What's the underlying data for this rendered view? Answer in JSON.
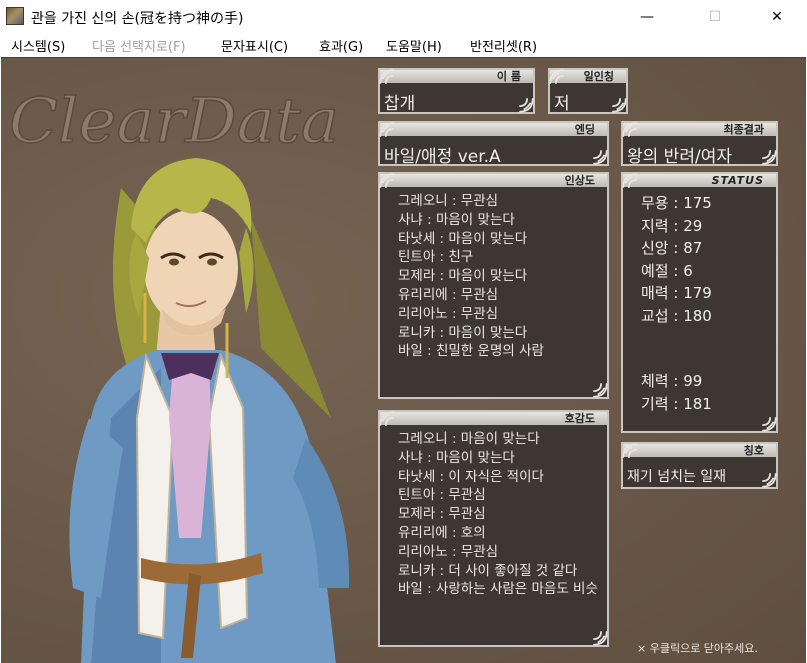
{
  "window": {
    "title": "관을 가진 신의 손(冠を持つ神の手)",
    "minimize": "—",
    "maximize": "☐",
    "close": "✕"
  },
  "menu": [
    {
      "label": "시스템(S)",
      "enabled": true
    },
    {
      "label": "다음 선택지로(F)",
      "enabled": false
    },
    {
      "label": "문자표시(C)",
      "enabled": true
    },
    {
      "label": "효과(G)",
      "enabled": true
    },
    {
      "label": "도움말(H)",
      "enabled": true
    },
    {
      "label": "반전리셋(R)",
      "enabled": true
    }
  ],
  "logo_text": "ClearData",
  "name_panel": {
    "label": "이 름",
    "value": "찹개"
  },
  "pronoun_panel": {
    "label": "일인칭",
    "value": "저"
  },
  "ending_panel": {
    "label": "엔딩",
    "value": "바일/애정   ver.A"
  },
  "result_panel": {
    "label": "최종결과",
    "value": "왕의 반려/여자"
  },
  "impression_panel": {
    "label": "인상도",
    "rows": [
      "그레오니 : 무관심",
      "사냐 : 마음이 맞는다",
      "타낫세 : 마음이 맞는다",
      "틴트아 : 친구",
      "모제라 : 마음이 맞는다",
      "유리리에 : 무관심",
      "리리아노 : 무관심",
      "로니카 : 마음이 맞는다",
      "바일 : 친밀한 운명의 사람"
    ]
  },
  "affection_panel": {
    "label": "호감도",
    "rows": [
      "그레오니 : 마음이 맞는다",
      "사냐 : 마음이 맞는다",
      "타낫세 : 이 자식은 적이다",
      "틴트아 : 무관심",
      "모제라 : 무관심",
      "유리리에 : 호의",
      "리리아노 : 무관심",
      "로니카 : 더 사이 좋아질 것 같다",
      "바일 : 사랑하는 사람은 마음도 비슷"
    ]
  },
  "status_panel": {
    "label": "STATUS",
    "stats": [
      "무용 : 175",
      "지력 : 29",
      "신앙 : 87",
      "예절 : 6",
      "매력 : 179",
      "교섭 : 180"
    ],
    "vitals": [
      "체력 : 99",
      "기력 : 181"
    ]
  },
  "title_panel": {
    "label": "칭호",
    "value": "재기 넘치는 일재"
  },
  "footer_note": "× 우클릭으로 닫아주세요.",
  "colors": {
    "background": "#6f5c4a",
    "panel": "#3d3633",
    "panel_border": "#c9c6c1",
    "panel_text": "#f2f0ec"
  }
}
